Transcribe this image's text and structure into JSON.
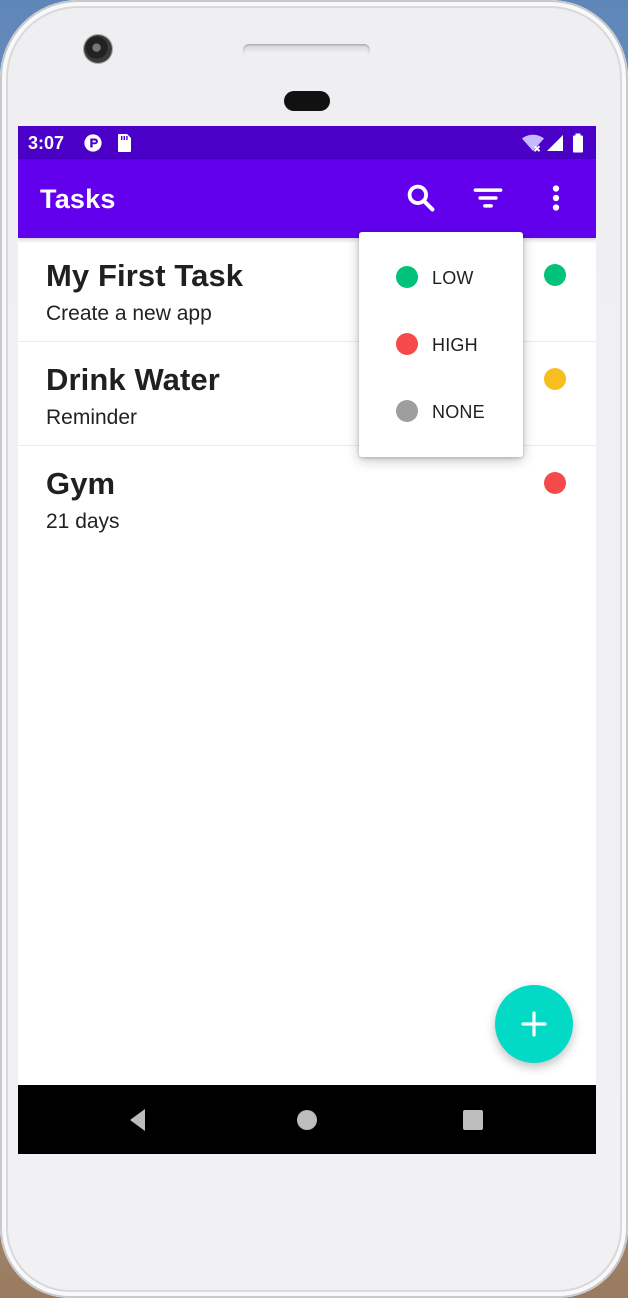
{
  "status_bar": {
    "time": "3:07",
    "icons": [
      "p-circle-icon",
      "sd-card-icon",
      "wifi-off-icon",
      "signal-icon",
      "battery-icon"
    ]
  },
  "app_bar": {
    "title": "Tasks",
    "actions": [
      "search-icon",
      "filter-icon",
      "more-vert-icon"
    ]
  },
  "tasks": [
    {
      "title": "My First Task",
      "description": "Create a new app",
      "priority_color": "#00c27a"
    },
    {
      "title": "Drink Water",
      "description": "Reminder",
      "priority_color": "#f8bd1f"
    },
    {
      "title": "Gym",
      "description": "21 days",
      "priority_color": "#f44a4a"
    }
  ],
  "filter_menu": {
    "items": [
      {
        "label": "LOW",
        "color": "#00c27a"
      },
      {
        "label": "HIGH",
        "color": "#f44a4a"
      },
      {
        "label": "NONE",
        "color": "#9e9e9e"
      }
    ]
  },
  "fab": {
    "icon": "plus-icon",
    "color": "#03dac5"
  },
  "colors": {
    "status_bar": "#4a00c7",
    "app_bar": "#6200ee"
  }
}
